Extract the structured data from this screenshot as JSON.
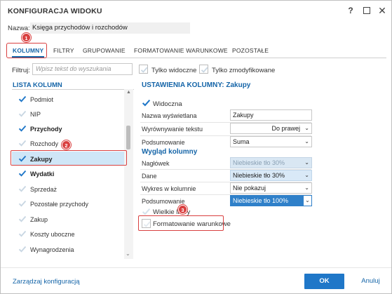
{
  "window": {
    "title": "KONFIGURACJA WIDOKU",
    "help_label": "?",
    "close_label": "✕"
  },
  "name_field": {
    "label": "Nazwa:",
    "value": "Księga przychodów i rozchodów"
  },
  "badges": [
    "1",
    "2",
    "3"
  ],
  "tabs": [
    {
      "label": "KOLUMNY",
      "active": true
    },
    {
      "label": "FILTRY",
      "active": false
    },
    {
      "label": "GRUPOWANIE",
      "active": false
    },
    {
      "label": "FORMATOWANIE WARUNKOWE",
      "active": false
    },
    {
      "label": "POZOSTAŁE",
      "active": false
    }
  ],
  "filter": {
    "label": "Filtruj:",
    "placeholder": "Wpisz tekst do wyszukania",
    "only_visible_label": "Tylko widoczne",
    "only_modified_label": "Tylko zmodyfikowane"
  },
  "column_list": {
    "title": "LISTA KOLUMN",
    "items": [
      {
        "label": "Podmiot",
        "checked": true,
        "bold": false
      },
      {
        "label": "NIP",
        "checked": false,
        "bold": false
      },
      {
        "label": "Przychody",
        "checked": true,
        "bold": true
      },
      {
        "label": "Rozchody",
        "checked": false,
        "bold": false
      },
      {
        "label": "Zakupy",
        "checked": true,
        "bold": true,
        "selected": true
      },
      {
        "label": "Wydatki",
        "checked": true,
        "bold": true
      },
      {
        "label": "Sprzedaż",
        "checked": false,
        "bold": false
      },
      {
        "label": "Pozostałe przychody",
        "checked": false,
        "bold": false
      },
      {
        "label": "Zakup",
        "checked": false,
        "bold": false
      },
      {
        "label": "Koszty uboczne",
        "checked": false,
        "bold": false
      },
      {
        "label": "Wynagrodzenia",
        "checked": false,
        "bold": false
      }
    ]
  },
  "settings": {
    "title": "USTAWIENIA KOLUMNY: Zakupy",
    "visible_label": "Widoczna",
    "display_name_label": "Nazwa wyświetlana",
    "display_name_value": "Zakupy",
    "alignment_label": "Wyrównywanie tekstu",
    "alignment_value": "Do prawej",
    "summary_label": "Podsumowanie",
    "summary_value": "Suma"
  },
  "appearance": {
    "title": "Wygląd kolumny",
    "header_label": "Nagłówek",
    "header_value": "Niebieskie tło 30%",
    "data_label": "Dane",
    "data_value": "Niebieskie tło 30%",
    "highlight_label": "Wykres w kolumnie",
    "highlight_value": "Nie pokazuj",
    "summary_label": "Podsumowanie",
    "summary_value": "Niebieskie tło 100%",
    "uppercase_label": "Wielkie litery",
    "conditional_label": "Formatowanie warunkowe"
  },
  "footer": {
    "manage_label": "Zarządzaj konfiguracją",
    "ok_label": "OK",
    "cancel_label": "Anuluj"
  },
  "colors": {
    "accent": "#1565a8",
    "ok_button": "#1f77c8",
    "selection": "#cfe6f7",
    "highlight": "#d94040"
  }
}
